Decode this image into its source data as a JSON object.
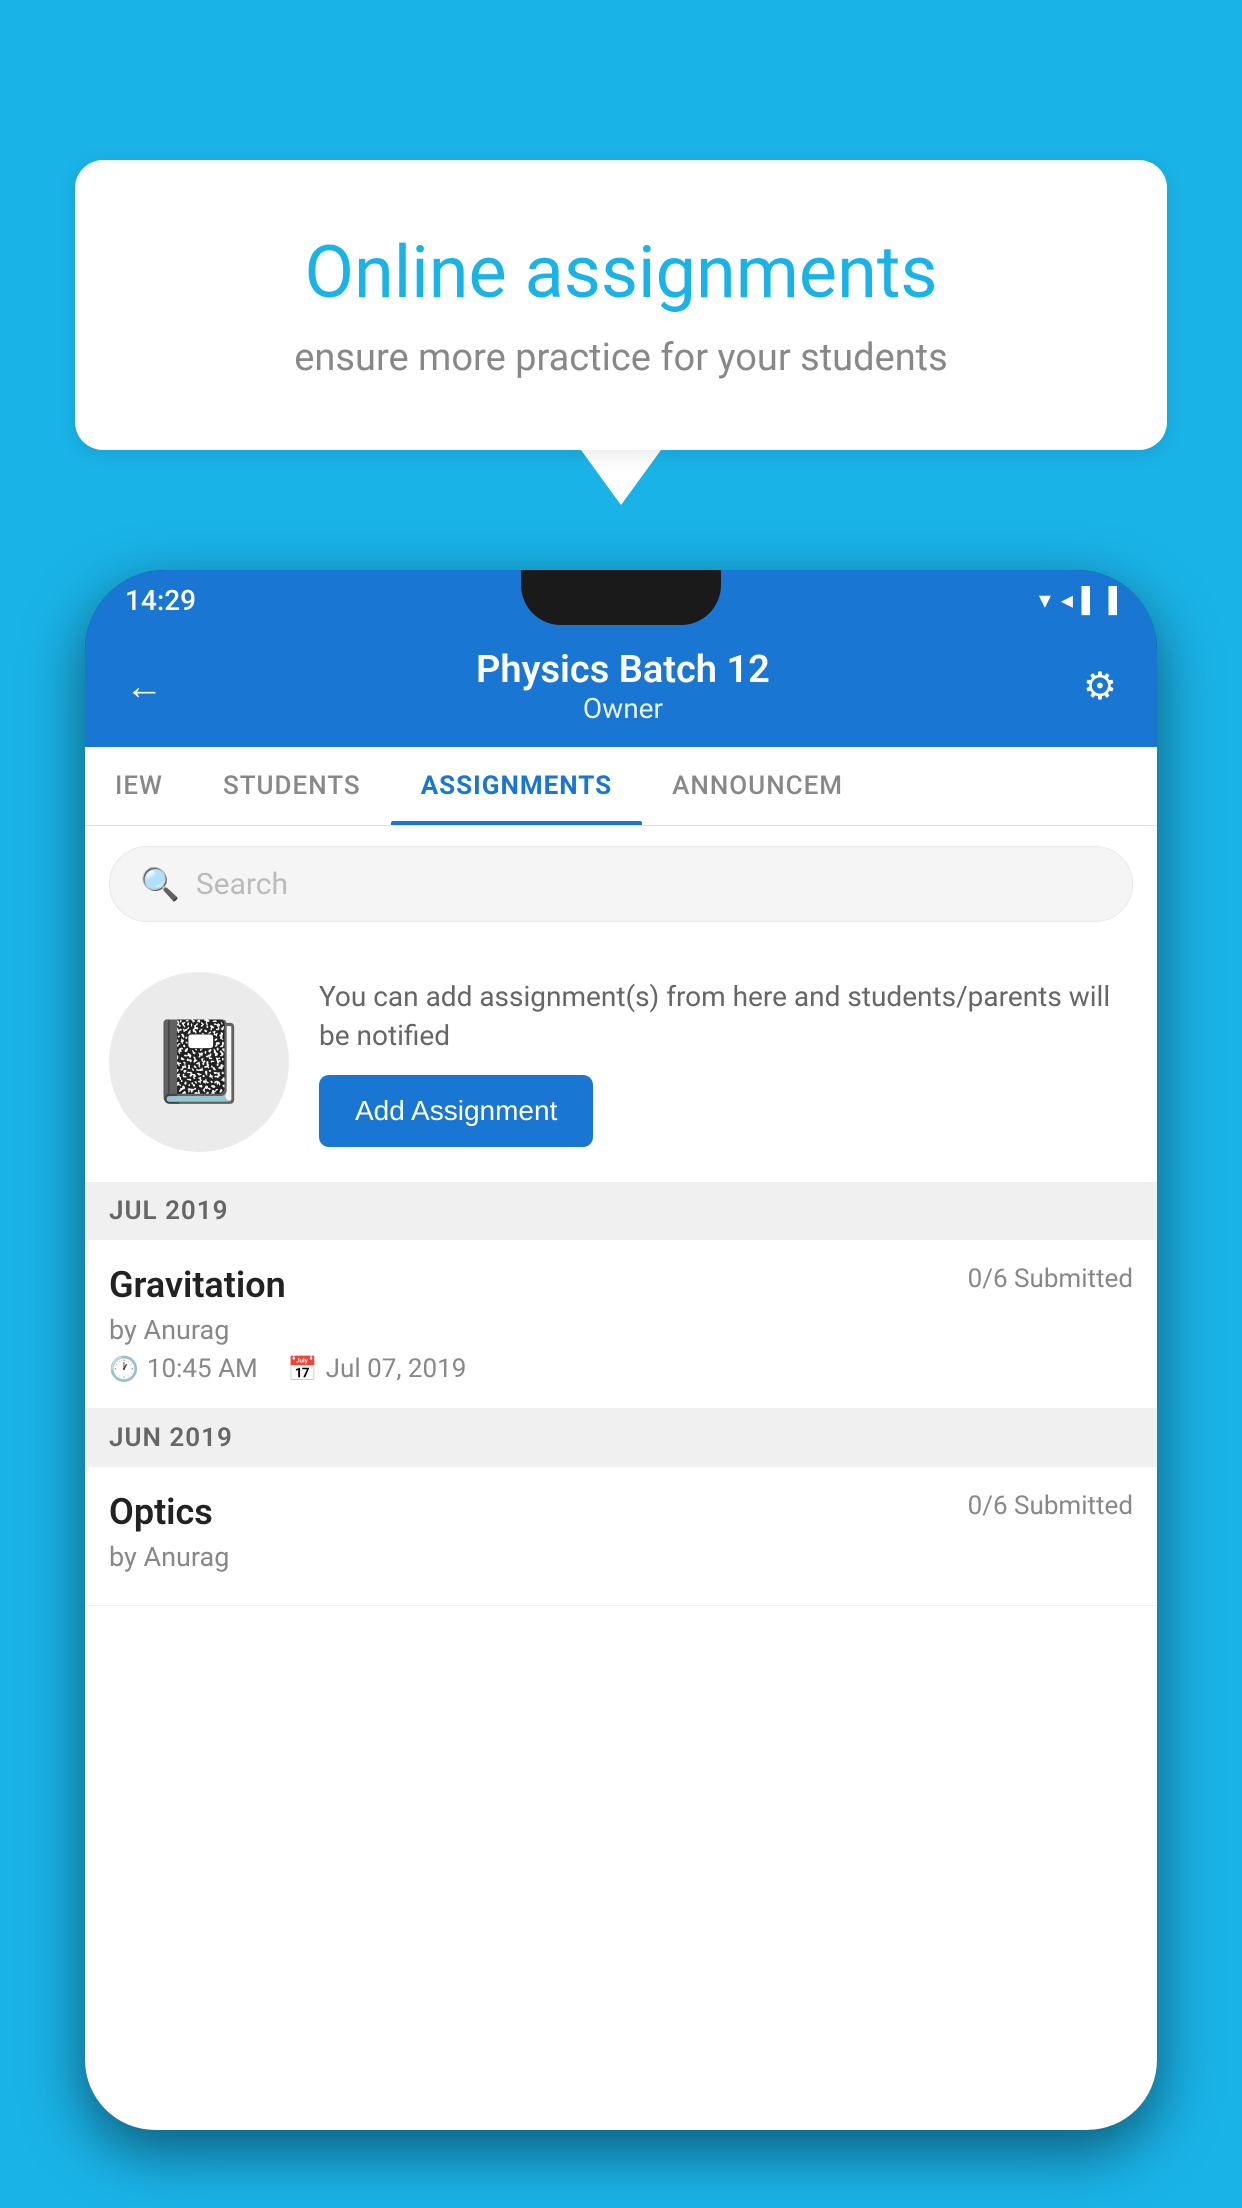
{
  "background_color": "#1ab3e8",
  "speech_bubble": {
    "title": "Online assignments",
    "subtitle": "ensure more practice for your students"
  },
  "status_bar": {
    "time": "14:29",
    "icons": [
      "▾",
      "◂",
      "▐"
    ]
  },
  "header": {
    "title": "Physics Batch 12",
    "subtitle": "Owner",
    "back_label": "←",
    "gear_label": "⚙"
  },
  "tabs": [
    {
      "label": "IEW",
      "active": false
    },
    {
      "label": "STUDENTS",
      "active": false
    },
    {
      "label": "ASSIGNMENTS",
      "active": true
    },
    {
      "label": "ANNOUNCEM",
      "active": false
    }
  ],
  "search": {
    "placeholder": "Search"
  },
  "promo": {
    "description": "You can add assignment(s) from here and students/parents will be notified",
    "button_label": "Add Assignment"
  },
  "sections": [
    {
      "header": "JUL 2019",
      "assignments": [
        {
          "name": "Gravitation",
          "submitted": "0/6 Submitted",
          "author": "by Anurag",
          "time": "10:45 AM",
          "date": "Jul 07, 2019"
        }
      ]
    },
    {
      "header": "JUN 2019",
      "assignments": [
        {
          "name": "Optics",
          "submitted": "0/6 Submitted",
          "author": "by Anurag",
          "time": "",
          "date": ""
        }
      ]
    }
  ]
}
